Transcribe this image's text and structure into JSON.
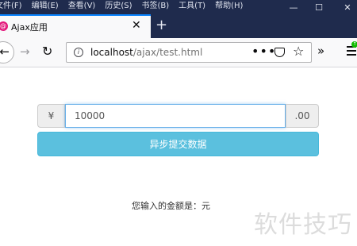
{
  "menu": [
    "文件(F)",
    "编辑(E)",
    "查看(V)",
    "历史(S)",
    "书签(B)",
    "工具(T)",
    "帮助(H)"
  ],
  "window_controls": {
    "minimize": "—",
    "maximize": "☐",
    "close": "✕"
  },
  "tab": {
    "title": "Ajax应用",
    "close": "✕",
    "new_tab": "+"
  },
  "nav": {
    "back": "←",
    "forward": "→",
    "reload": "↻",
    "url_host": "localhost",
    "url_path": "/ajax/test.html",
    "more": "•••",
    "star": "☆",
    "overflow": "»"
  },
  "form": {
    "currency_symbol": "¥",
    "amount_value": "10000",
    "decimal_suffix": ".00",
    "submit_label": "异步提交数据"
  },
  "result": {
    "text": "您输入的金额是：元"
  },
  "watermark": "软件技巧",
  "colors": {
    "accent": "#0a84ff",
    "button": "#5bc0de",
    "titlebar": "#1f2b4d",
    "focus_border": "#66afe9"
  }
}
